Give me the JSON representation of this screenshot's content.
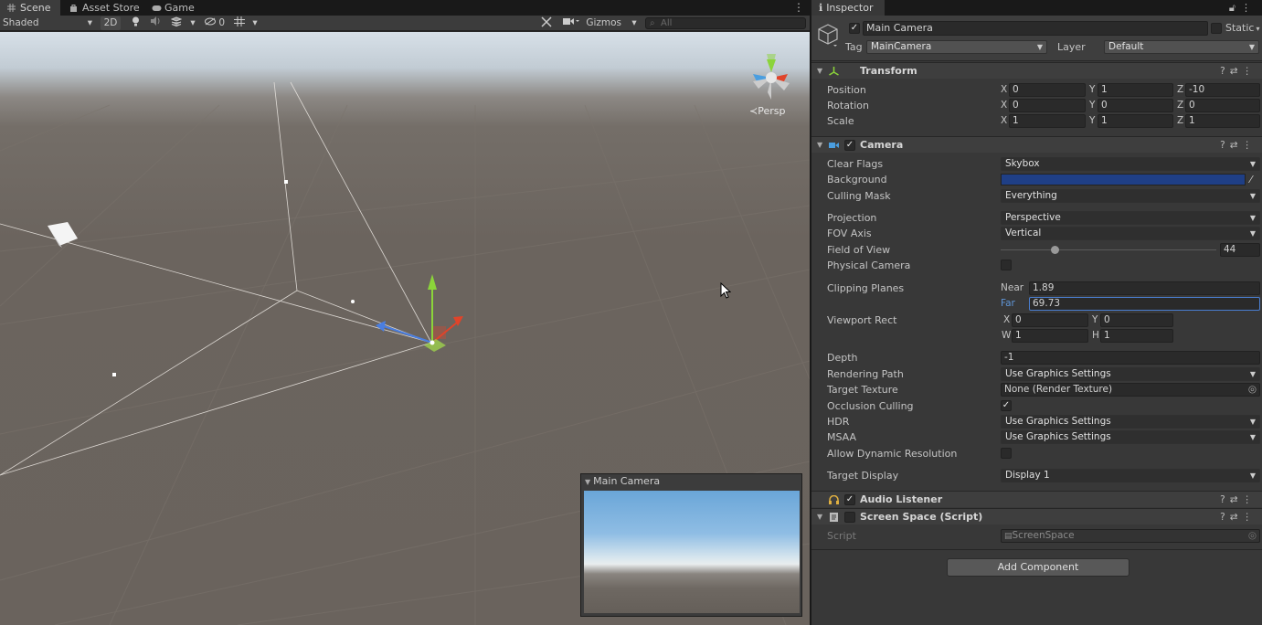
{
  "scene_tabs": {
    "scene": "Scene",
    "asset_store": "Asset Store",
    "game": "Game"
  },
  "scene_toolbar": {
    "shading_mode": "Shaded",
    "mode_2d": "2D",
    "hidden_count": "0",
    "gizmos": "Gizmos",
    "search_placeholder": "All"
  },
  "viewport": {
    "projection_label": "Persp"
  },
  "camera_preview": {
    "title": "Main Camera"
  },
  "inspector": {
    "tab_title": "Inspector",
    "object_name": "Main Camera",
    "static_label": "Static",
    "tag_label": "Tag",
    "tag_value": "MainCamera",
    "layer_label": "Layer",
    "layer_value": "Default",
    "transform": {
      "title": "Transform",
      "position_label": "Position",
      "rotation_label": "Rotation",
      "scale_label": "Scale",
      "position": {
        "x": "0",
        "y": "1",
        "z": "-10"
      },
      "rotation": {
        "x": "0",
        "y": "0",
        "z": "0"
      },
      "scale": {
        "x": "1",
        "y": "1",
        "z": "1"
      }
    },
    "camera": {
      "title": "Camera",
      "clear_flags_label": "Clear Flags",
      "clear_flags": "Skybox",
      "background_label": "Background",
      "background_color": "#1f3f86",
      "culling_mask_label": "Culling Mask",
      "culling_mask": "Everything",
      "projection_label": "Projection",
      "projection": "Perspective",
      "fov_axis_label": "FOV Axis",
      "fov_axis": "Vertical",
      "fov_label": "Field of View",
      "fov_value": "44",
      "fov_slider_fraction": 0.25,
      "physical_camera_label": "Physical Camera",
      "clipping_label": "Clipping Planes",
      "near_label": "Near",
      "near": "1.89",
      "far_label": "Far",
      "far": "69.73",
      "viewport_label": "Viewport Rect",
      "vp_x": "0",
      "vp_y": "0",
      "vp_w": "1",
      "vp_h": "1",
      "depth_label": "Depth",
      "depth": "-1",
      "rendering_path_label": "Rendering Path",
      "rendering_path": "Use Graphics Settings",
      "target_texture_label": "Target Texture",
      "target_texture": "None (Render Texture)",
      "occlusion_label": "Occlusion Culling",
      "hdr_label": "HDR",
      "hdr": "Use Graphics Settings",
      "msaa_label": "MSAA",
      "msaa": "Use Graphics Settings",
      "dynamic_res_label": "Allow Dynamic Resolution",
      "target_display_label": "Target Display",
      "target_display": "Display 1"
    },
    "audio_listener": {
      "title": "Audio Listener"
    },
    "screen_space": {
      "title": "Screen Space (Script)",
      "script_label": "Script",
      "script_value": "ScreenSpace"
    },
    "add_component": "Add Component"
  },
  "axis_labels": {
    "x": "X",
    "y": "Y",
    "z": "Z",
    "w": "W",
    "h": "H"
  }
}
